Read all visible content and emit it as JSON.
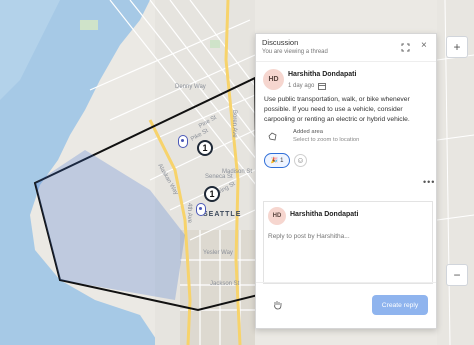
{
  "map": {
    "city_label": "SEATTLE",
    "clusters": [
      {
        "count": "1"
      },
      {
        "count": "1"
      }
    ],
    "labels": [
      "Pike St",
      "Pine St",
      "Seneca St",
      "Madison St",
      "Yesler Way",
      "Jackson St",
      "Spring St",
      "Boren Ave",
      "Denny Way",
      "4th Ave",
      "Alaskan Way"
    ]
  },
  "panel": {
    "title": "Discussion",
    "subtitle": "You are viewing a thread",
    "post": {
      "initials": "HD",
      "author": "Harshitha Dondapati",
      "time": "1 day ago",
      "text": "Use public transportation, walk, or bike whenever possible. If you need to use a vehicle, consider carpooling or renting an electric or hybrid vehicle.",
      "area_title": "Added area",
      "area_sub": "Select to zoom to location",
      "reaction_count": "1"
    },
    "reply": {
      "initials": "HD",
      "author": "Harshitha Dondapati",
      "placeholder": "Reply to post by Harshitha..."
    },
    "create_reply_label": "Create reply"
  }
}
